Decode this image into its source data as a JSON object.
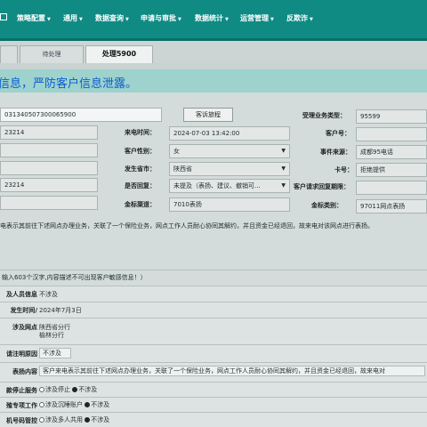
{
  "nav": {
    "items": [
      {
        "label": "策略配置"
      },
      {
        "label": "通用"
      },
      {
        "label": "数据查询"
      },
      {
        "label": "申请与审批"
      },
      {
        "label": "数据统计"
      },
      {
        "label": "运营管理"
      },
      {
        "label": "反欺诈"
      }
    ]
  },
  "tabs": [
    {
      "label": "待处理"
    },
    {
      "label": "处理5900"
    }
  ],
  "banner": {
    "text": "信息，严防客户信息泄露。"
  },
  "form": {
    "order_no": "031340507300065900",
    "complaint_flow_button": "客诉旅程",
    "biz_type_label": "受理业务类型：",
    "biz_type_value": "95599",
    "field_a": "23214",
    "call_time_label": "来电时间：",
    "call_time_value": "2024-07-03 13:42:00",
    "customer_no_label": "客户号：",
    "customer_no_value": "",
    "field_b": "",
    "gender_label": "客户性别：",
    "gender_value": "女",
    "event_source_label": "事件来源：",
    "event_source_value": "成都95电话",
    "field_c": "",
    "province_label": "发生省市：",
    "province_value": "陕西省",
    "card_label": "卡号：",
    "card_value": "拒绝提供",
    "field_d": "23214",
    "reply_label": "是否回复：",
    "reply_value": "未提及（表扬、建议、撤销可...",
    "reply_deadline_label": "客户请求回复期限：",
    "reply_deadline_value": "",
    "field_e": "",
    "channel_label": "金标渠道：",
    "channel_value": "7010表扬",
    "category_label": "金标类别：",
    "category_value": "97011网点表扬",
    "description": "电表示其前往下述网点办理业务，关联了一个保险业务，网点工作人员耐心协同其解约，并且资金已经退回，故来电对该网点进行表扬。"
  },
  "note": "输入603个汉字,内容描述不可出现客户敏感信息！）",
  "details": {
    "personnel_label": "及人员信息",
    "personnel_value": "不涉及",
    "occur_time_label": "/发生时间",
    "occur_time_value": "2024年7月3日",
    "branch_label": "涉及网点",
    "branch_value_1": "陕西省分行",
    "branch_value_2": "榆林分行",
    "unclear_label": "请注明原因",
    "unclear_value": "不涉及",
    "praise_label": "表扬内容",
    "praise_value": "客户来电表示其前往下述网点办理业务，关联了一个保险业务，网点工作人员耐心协同其解约，并且资金已经退回，故来电对",
    "stop_label": "款停止服务",
    "stop_opt1": "涉及停止",
    "stop_opt2": "不涉及",
    "special_label": "殖专项工作",
    "special_opt1": "涉及沉睡账户",
    "special_opt2": "不涉及",
    "device_label": "机号码管控",
    "device_opt1": "涉及多人共用",
    "device_opt2": "不涉及"
  }
}
